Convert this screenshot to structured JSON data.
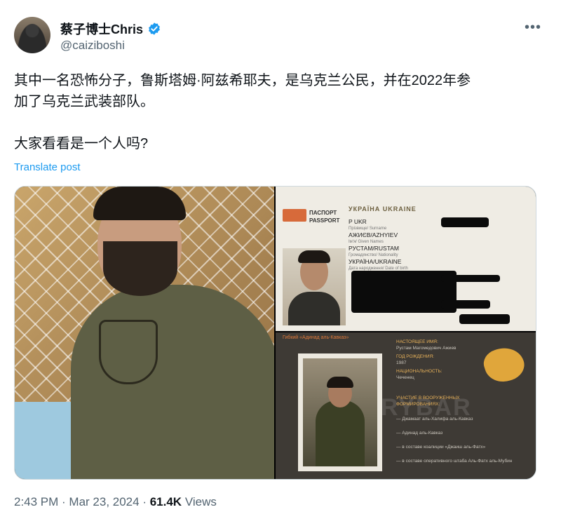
{
  "post": {
    "author_name": "蔡子博士Chris",
    "author_handle": "@caiziboshi",
    "more_icon": "•••",
    "text_line1": "其中一名恐怖分子，鲁斯塔姆·阿兹希耶夫，是乌克兰公民，并在2022年参",
    "text_line2": "加了乌克兰武装部队。",
    "text_line3": "大家看看是一个人吗?",
    "translate_label": "Translate post",
    "time": "2:43 PM",
    "sep1": " · ",
    "date": "Mar 23, 2024",
    "sep2": " · ",
    "views_count": "61.4K",
    "views_label": " Views"
  },
  "passport": {
    "country_header": "УКРАЇНА  UKRAINE",
    "doc_label_ua": "ПАСПОРТ",
    "doc_label_en": "PASSPORT",
    "type_line": "P        UKR",
    "surname_label": "Прізвище/ Surname",
    "surname": "АЖИЄВ/AZHYIEV",
    "given_label": "Ім'я/ Given Names",
    "given": "РУСТАМ/RUSTAM",
    "nationality_label": "Громадянство/ Nationality",
    "nationality": "УКРАЇНА/UKRAINE",
    "dob_label": "Дата народження/ Date of birth"
  },
  "profile_card": {
    "caption": "Гибкий «Адинад аль-Кавказ»",
    "line1": "НАСТОЯЩЕЕ ИМЯ:",
    "line2": "Рустам Магомедович Ажиев",
    "line3": "ГОД РОЖДЕНИЯ:",
    "line4": "1987",
    "line5": "НАЦИОНАЛЬНОСТЬ:",
    "line6": "Чеченец",
    "line7": "УЧАСТИЕ В ВООРУЖЕННЫХ",
    "line8": "ФОРМИРОВАНИЯХ:",
    "line9": "— Джамаат аль-Халифа аль-Кавказ",
    "line10": "— Адинад аль-Кавказ",
    "line11": "— в составе коалиции «Джаиш аль-Фатх»",
    "line12": "— в составе оперативного штаба Аль-Фатх аль-Мубин",
    "watermark": "RYBAR"
  },
  "colors": {
    "link": "#1d9bf0",
    "secondary_text": "#536471",
    "verified": "#1d9bf0"
  }
}
